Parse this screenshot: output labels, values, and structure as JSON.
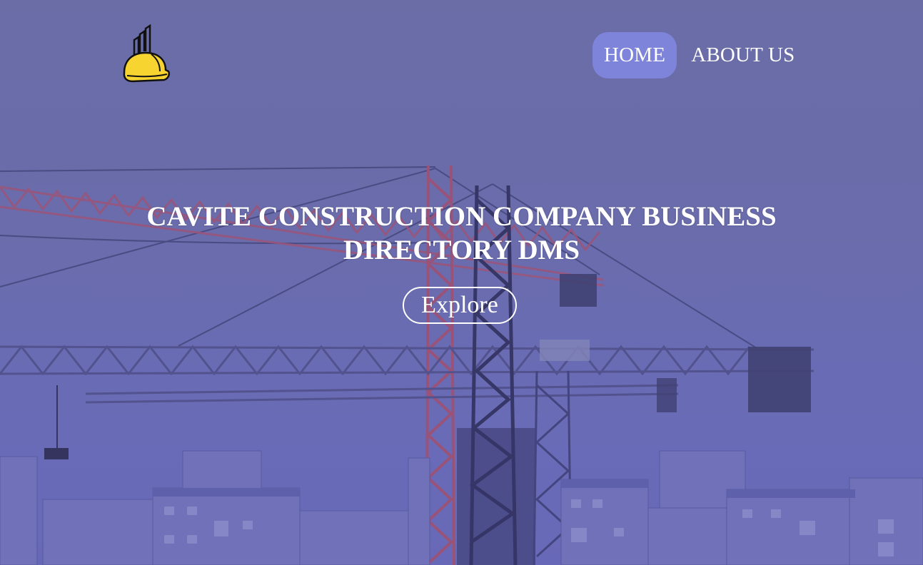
{
  "nav": {
    "items": [
      {
        "label": "HOME",
        "active": true
      },
      {
        "label": "ABOUT US",
        "active": false
      }
    ],
    "active_bg": "#7e84d9"
  },
  "hero": {
    "title": "CAVITE CONSTRUCTION COMPANY BUSINESS DIRECTORY DMS",
    "button_label": "Explore",
    "overlay_color": "#6d6fb6"
  },
  "logo": {
    "icon": "hard-hat-buildings-icon",
    "color": "#f7d430"
  }
}
